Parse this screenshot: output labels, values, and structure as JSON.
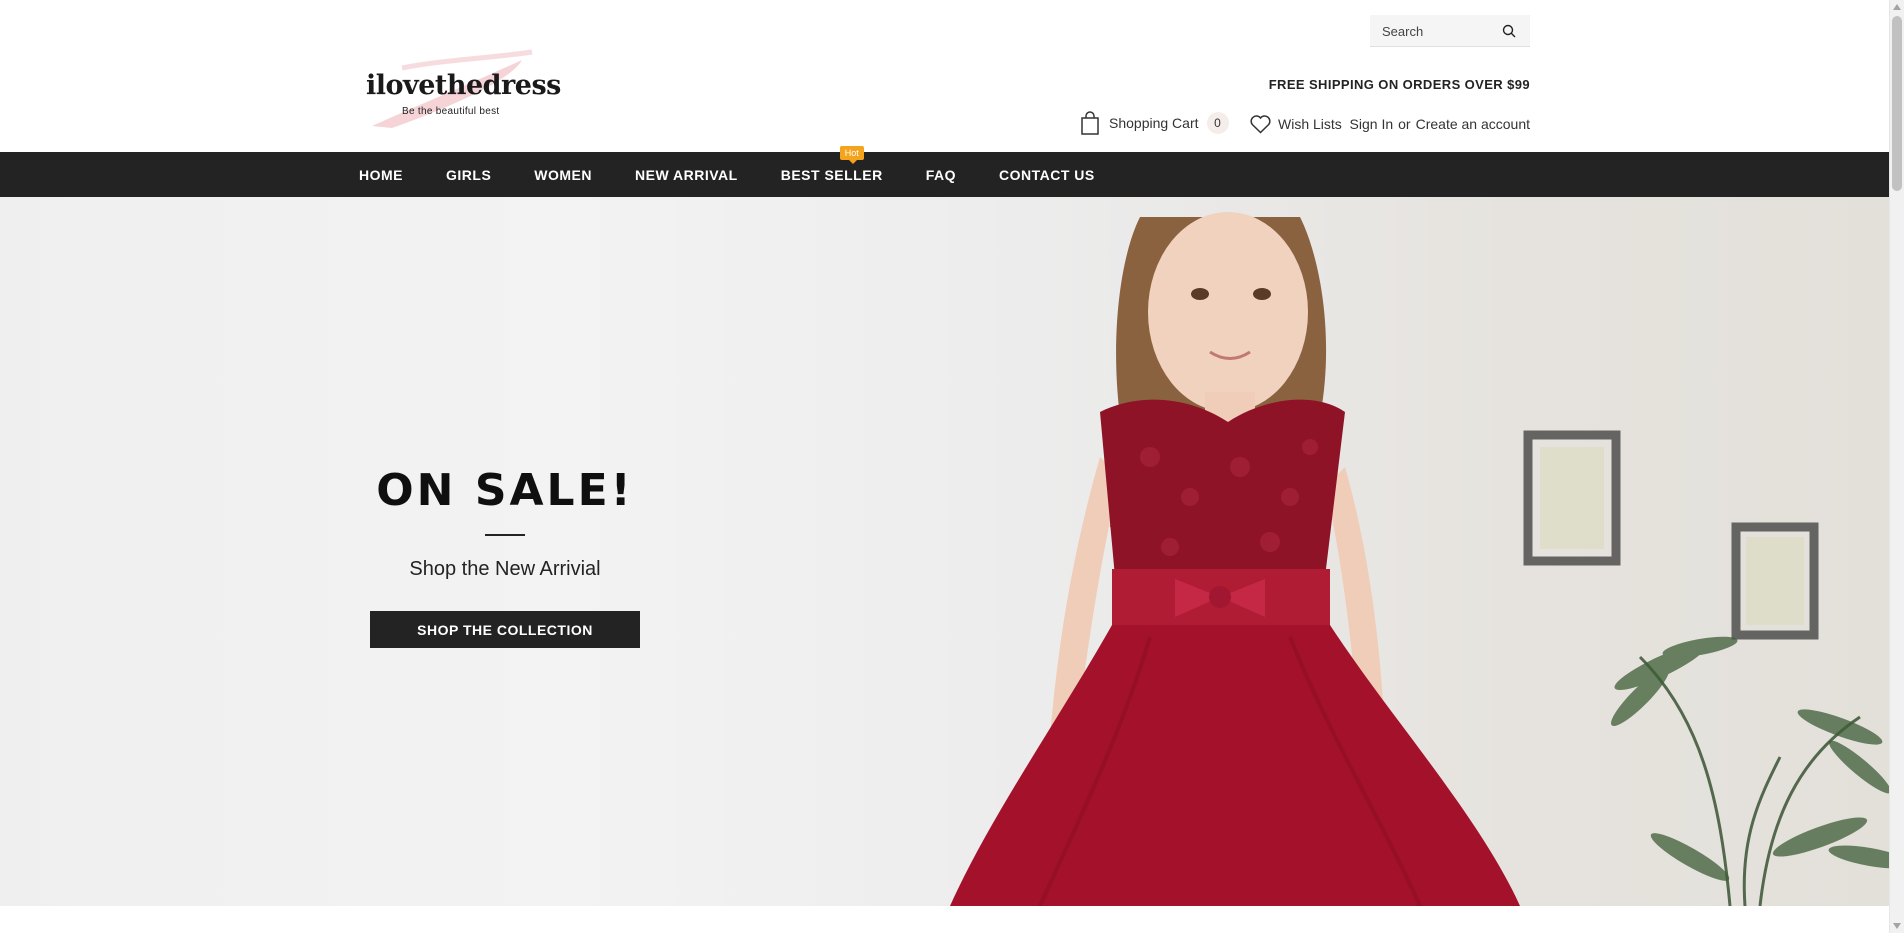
{
  "header": {
    "search": {
      "placeholder": "Search",
      "icon": "search-icon"
    },
    "logo": {
      "text": "ilovethedress",
      "tagline": "Be the beautiful best"
    },
    "free_shipping": "FREE SHIPPING ON ORDERS OVER $99",
    "cart": {
      "label": "Shopping Cart",
      "count": "0",
      "icon": "shopping-bag-icon"
    },
    "wishlist": {
      "label": "Wish Lists",
      "icon": "heart-icon"
    },
    "account": {
      "sign_in": "Sign In",
      "or": "or",
      "create": "Create an account"
    }
  },
  "nav": {
    "items": [
      {
        "label": "HOME"
      },
      {
        "label": "GIRLS"
      },
      {
        "label": "WOMEN"
      },
      {
        "label": "NEW ARRIVAL"
      },
      {
        "label": "BEST SELLER",
        "badge": "Hot"
      },
      {
        "label": "FAQ"
      },
      {
        "label": "CONTACT US"
      }
    ]
  },
  "hero": {
    "title": "ON SALE!",
    "subtitle": "Shop the New Arrivial",
    "button": "SHOP THE COLLECTION"
  },
  "colors": {
    "nav_bg": "#232323",
    "badge": "#f4a31c",
    "dress_red": "#a3112a",
    "cart_badge_bg": "#f5ede9"
  }
}
